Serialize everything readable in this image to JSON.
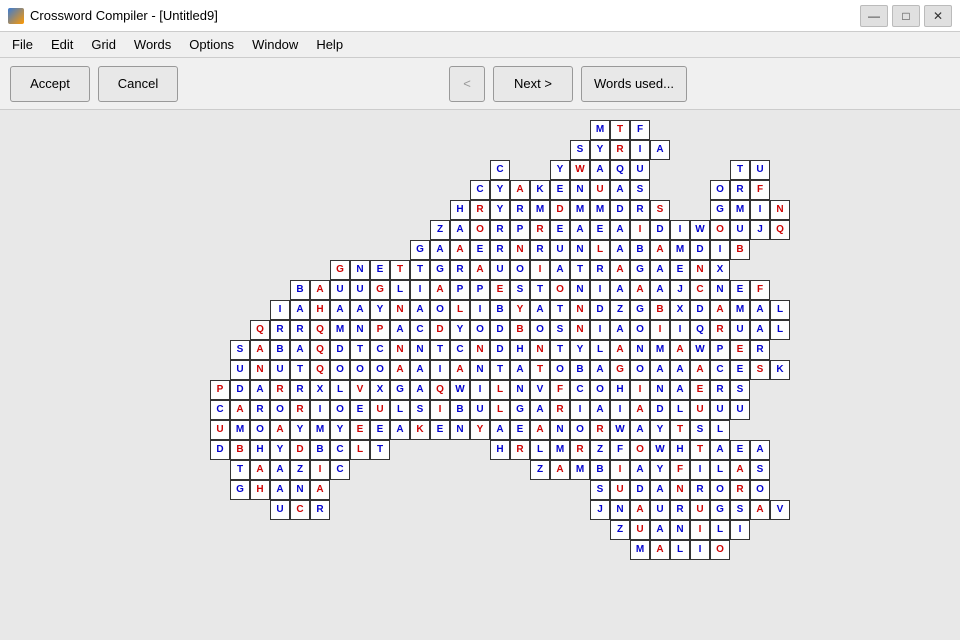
{
  "window": {
    "title": "Crossword Compiler - [Untitled9]",
    "icon": "crossword-icon"
  },
  "titlebar": {
    "controls": {
      "minimize": "—",
      "maximize": "□",
      "close": "✕"
    }
  },
  "menubar": {
    "items": [
      "File",
      "Edit",
      "Grid",
      "Words",
      "Options",
      "Window",
      "Help"
    ]
  },
  "toolbar": {
    "accept_label": "Accept",
    "cancel_label": "Cancel",
    "prev_label": "<",
    "next_label": "Next >",
    "words_used_label": "Words used..."
  },
  "grid": {
    "cell_size": 20,
    "accent_color": "#0000cc",
    "red_color": "#cc0000"
  }
}
